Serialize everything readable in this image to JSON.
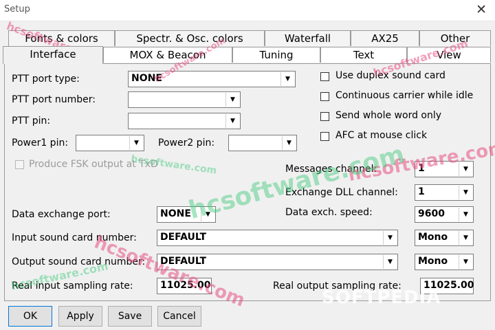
{
  "window": {
    "title": "Setup",
    "close_glyph": "✕"
  },
  "tabs": {
    "row1": [
      "Fonts & colors",
      "Spectr. & Osc. colors",
      "Waterfall",
      "AX25",
      "Other"
    ],
    "row2": [
      "Interface",
      "MOX & Beacon",
      "Tuning",
      "Text",
      "View"
    ],
    "active": "Interface"
  },
  "ptt": {
    "port_type_label": "PTT port type:",
    "port_type_value": "NONE",
    "port_number_label": "PTT port number:",
    "port_number_value": "",
    "pin_label": "PTT pin:",
    "pin_value": "",
    "power1_label": "Power1 pin:",
    "power1_value": "",
    "power2_label": "Power2 pin:",
    "power2_value": ""
  },
  "fsk": {
    "label": "Produce FSK output at TxD",
    "checked": false,
    "enabled": false
  },
  "options": [
    {
      "label": "Use duplex sound card",
      "checked": false
    },
    {
      "label": "Continuous carrier while idle",
      "checked": false
    },
    {
      "label": "Send whole word only",
      "checked": false
    },
    {
      "label": "AFC at mouse click",
      "checked": false
    }
  ],
  "channels": {
    "messages_label": "Messages channel:",
    "messages_value": "1",
    "exchange_dll_label": "Exchange DLL channel:",
    "exchange_dll_value": "1"
  },
  "data_exchange": {
    "port_label": "Data exchange port:",
    "port_value": "NONE",
    "speed_label": "Data exch. speed:",
    "speed_value": "9600"
  },
  "sound": {
    "input_label": "Input sound card number:",
    "input_value": "DEFAULT",
    "input_mode": "Mono",
    "output_label": "Output sound card number:",
    "output_value": "DEFAULT",
    "output_mode": "Mono"
  },
  "sampling": {
    "input_label": "Real input sampling rate:",
    "input_value": "11025.00",
    "output_label": "Real output sampling rate:",
    "output_value": "11025.00"
  },
  "buttons": {
    "ok": "OK",
    "apply": "Apply",
    "save": "Save",
    "cancel": "Cancel"
  },
  "watermarks": {
    "site": "hcsoftware.com",
    "softpedia": "SOFTPEDIA"
  }
}
